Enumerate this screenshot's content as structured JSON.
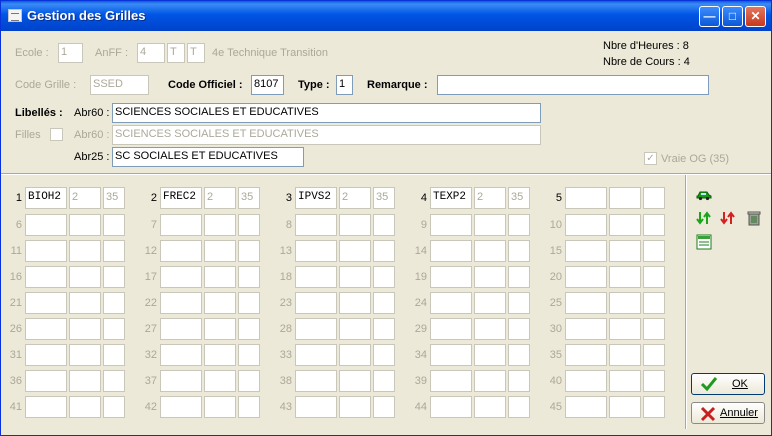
{
  "window": {
    "title": "Gestion des Grilles"
  },
  "header": {
    "ecole_label": "Ecole :",
    "ecole_value": "1",
    "anff_label": "AnFF :",
    "anff_value": "4",
    "anff_t1": "T",
    "anff_t2": "T",
    "anff_desc": "4e Technique Transition",
    "nbre_heures": "Nbre d'Heures : 8",
    "nbre_cours": "Nbre de Cours : 4",
    "code_grille_label": "Code Grille :",
    "code_grille_value": "SSED",
    "code_officiel_label": "Code Officiel :",
    "code_officiel_value": "8107",
    "type_label": "Type :",
    "type_value": "1",
    "remarque_label": "Remarque :",
    "remarque_value": ""
  },
  "libelles": {
    "libelles_label": "Libellés :",
    "filles_label": "Filles",
    "abr60_label": "Abr60 :",
    "abr60_value": "SCIENCES SOCIALES ET EDUCATIVES",
    "abr60_filles_label": "Abr60 :",
    "abr60_filles_value": "SCIENCES SOCIALES ET EDUCATIVES",
    "abr25_label": "Abr25 :",
    "abr25_value": "SC SOCIALES ET EDUCATIVES",
    "vraie_og_label": "Vraie OG (35)"
  },
  "grid": {
    "slots": [
      {
        "n": "1",
        "code": "BIOH2",
        "h": "2",
        "p": "35"
      },
      {
        "n": "2",
        "code": "FREC2",
        "h": "2",
        "p": "35"
      },
      {
        "n": "3",
        "code": "IPVS2",
        "h": "2",
        "p": "35"
      },
      {
        "n": "4",
        "code": "TEXP2",
        "h": "2",
        "p": "35"
      },
      {
        "n": "5",
        "code": "",
        "h": "",
        "p": ""
      },
      {
        "n": "6",
        "code": "",
        "h": "",
        "p": ""
      },
      {
        "n": "7",
        "code": "",
        "h": "",
        "p": ""
      },
      {
        "n": "8",
        "code": "",
        "h": "",
        "p": ""
      },
      {
        "n": "9",
        "code": "",
        "h": "",
        "p": ""
      },
      {
        "n": "10",
        "code": "",
        "h": "",
        "p": ""
      },
      {
        "n": "11",
        "code": "",
        "h": "",
        "p": ""
      },
      {
        "n": "12",
        "code": "",
        "h": "",
        "p": ""
      },
      {
        "n": "13",
        "code": "",
        "h": "",
        "p": ""
      },
      {
        "n": "14",
        "code": "",
        "h": "",
        "p": ""
      },
      {
        "n": "15",
        "code": "",
        "h": "",
        "p": ""
      },
      {
        "n": "16",
        "code": "",
        "h": "",
        "p": ""
      },
      {
        "n": "17",
        "code": "",
        "h": "",
        "p": ""
      },
      {
        "n": "18",
        "code": "",
        "h": "",
        "p": ""
      },
      {
        "n": "19",
        "code": "",
        "h": "",
        "p": ""
      },
      {
        "n": "20",
        "code": "",
        "h": "",
        "p": ""
      },
      {
        "n": "21",
        "code": "",
        "h": "",
        "p": ""
      },
      {
        "n": "22",
        "code": "",
        "h": "",
        "p": ""
      },
      {
        "n": "23",
        "code": "",
        "h": "",
        "p": ""
      },
      {
        "n": "24",
        "code": "",
        "h": "",
        "p": ""
      },
      {
        "n": "25",
        "code": "",
        "h": "",
        "p": ""
      },
      {
        "n": "26",
        "code": "",
        "h": "",
        "p": ""
      },
      {
        "n": "27",
        "code": "",
        "h": "",
        "p": ""
      },
      {
        "n": "28",
        "code": "",
        "h": "",
        "p": ""
      },
      {
        "n": "29",
        "code": "",
        "h": "",
        "p": ""
      },
      {
        "n": "30",
        "code": "",
        "h": "",
        "p": ""
      },
      {
        "n": "31",
        "code": "",
        "h": "",
        "p": ""
      },
      {
        "n": "32",
        "code": "",
        "h": "",
        "p": ""
      },
      {
        "n": "33",
        "code": "",
        "h": "",
        "p": ""
      },
      {
        "n": "34",
        "code": "",
        "h": "",
        "p": ""
      },
      {
        "n": "35",
        "code": "",
        "h": "",
        "p": ""
      },
      {
        "n": "36",
        "code": "",
        "h": "",
        "p": ""
      },
      {
        "n": "37",
        "code": "",
        "h": "",
        "p": ""
      },
      {
        "n": "38",
        "code": "",
        "h": "",
        "p": ""
      },
      {
        "n": "39",
        "code": "",
        "h": "",
        "p": ""
      },
      {
        "n": "40",
        "code": "",
        "h": "",
        "p": ""
      },
      {
        "n": "41",
        "code": "",
        "h": "",
        "p": ""
      },
      {
        "n": "42",
        "code": "",
        "h": "",
        "p": ""
      },
      {
        "n": "43",
        "code": "",
        "h": "",
        "p": ""
      },
      {
        "n": "44",
        "code": "",
        "h": "",
        "p": ""
      },
      {
        "n": "45",
        "code": "",
        "h": "",
        "p": ""
      }
    ]
  },
  "toolbar": {
    "icons": [
      "car-icon",
      "move-down-up-icon",
      "move-up-down-icon",
      "recycle-bin-icon",
      "list-icon"
    ]
  },
  "buttons": {
    "ok_label": "OK",
    "annuler_label": "Annuler"
  }
}
